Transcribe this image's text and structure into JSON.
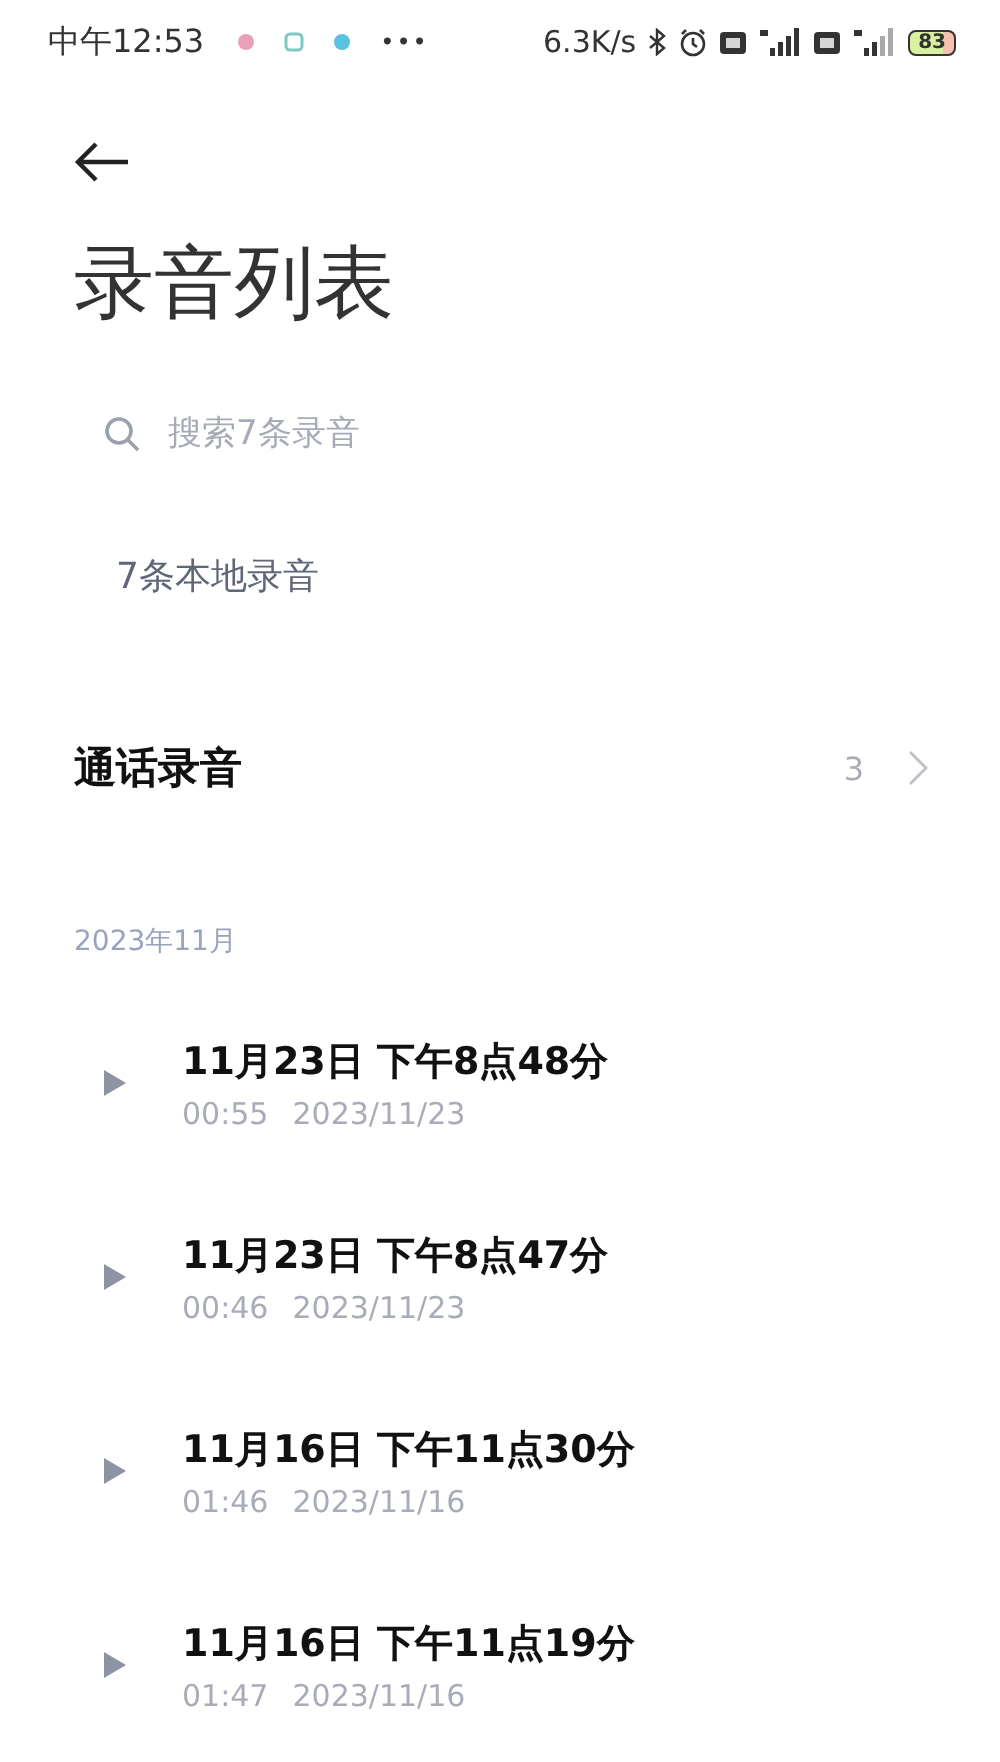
{
  "status_bar": {
    "time": "中午12:53",
    "more": "•••",
    "speed": "6.3K/s",
    "battery": "83"
  },
  "title": "录音列表",
  "search": {
    "placeholder": "搜索7条录音"
  },
  "local_count": "7条本地录音",
  "call_recordings": {
    "label": "通话录音",
    "count": "3"
  },
  "month": "2023年11月",
  "recordings": [
    {
      "name": "11月23日 下午8点48分",
      "duration": "00:55",
      "date": "2023/11/23"
    },
    {
      "name": "11月23日 下午8点47分",
      "duration": "00:46",
      "date": "2023/11/23"
    },
    {
      "name": "11月16日 下午11点30分",
      "duration": "01:46",
      "date": "2023/11/16"
    },
    {
      "name": "11月16日 下午11点19分",
      "duration": "01:47",
      "date": "2023/11/16"
    }
  ]
}
